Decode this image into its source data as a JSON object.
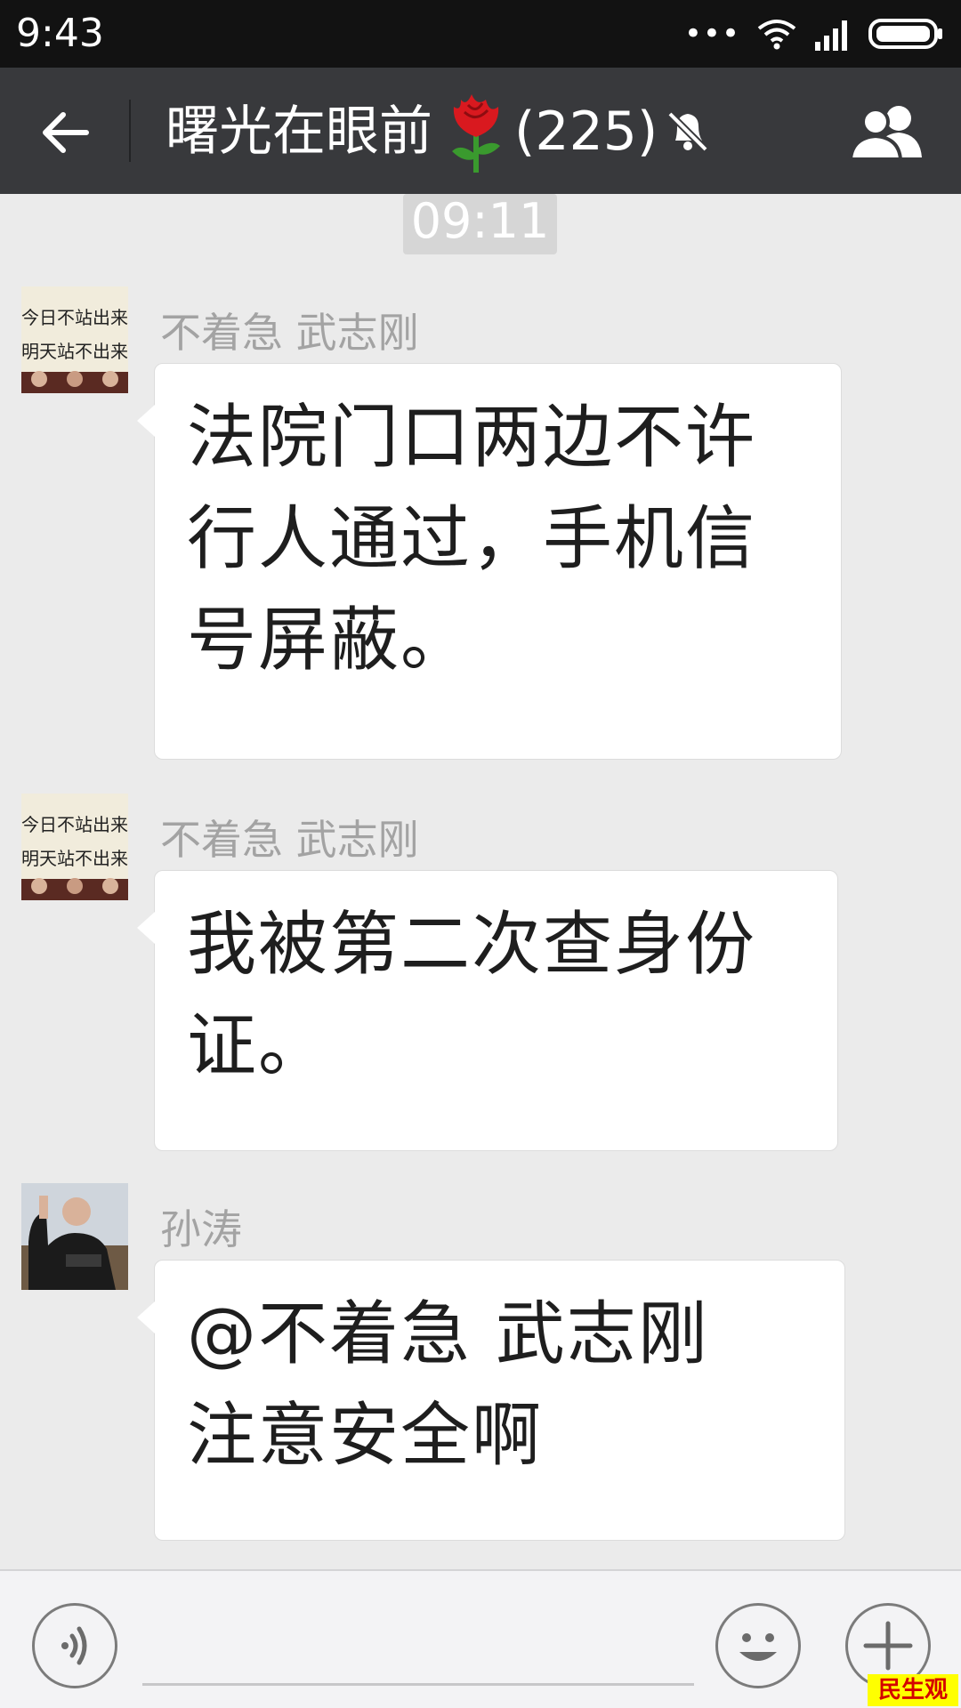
{
  "status_bar": {
    "time": "9:43",
    "dots": "•••"
  },
  "nav": {
    "title": "曙光在眼前",
    "member_count": "(225)"
  },
  "chat": {
    "timestamp": "09:11",
    "messages": [
      {
        "sender": "不着急 武志刚",
        "lines": [
          "法院门口两边不许",
          "行人通过，手机信",
          "号屏蔽。"
        ]
      },
      {
        "sender": "不着急 武志刚",
        "lines": [
          "我被第二次查身份",
          "证。"
        ]
      },
      {
        "sender": "孙涛",
        "lines": [
          "@不着急 武志刚",
          "注意安全啊"
        ]
      }
    ]
  },
  "avatars": {
    "sign_text": [
      "今日不站出来",
      "明天站不出来"
    ]
  },
  "watermark": "民生观察",
  "colors": {
    "status_bar": "#121212",
    "nav_bar": "#38393c",
    "chat_bg": "#ebebeb",
    "bubble": "#ffffff",
    "sender_text": "#a3a3a3",
    "watermark_bg": "#ffff00",
    "watermark_text": "#d40000"
  },
  "icons": {
    "back": "arrow-left-icon",
    "title_emoji": "rose-icon",
    "mute": "bell-muted-icon",
    "group_info": "group-people-icon",
    "voice": "voice-icon",
    "emoji": "smile-icon",
    "more": "plus-icon"
  }
}
